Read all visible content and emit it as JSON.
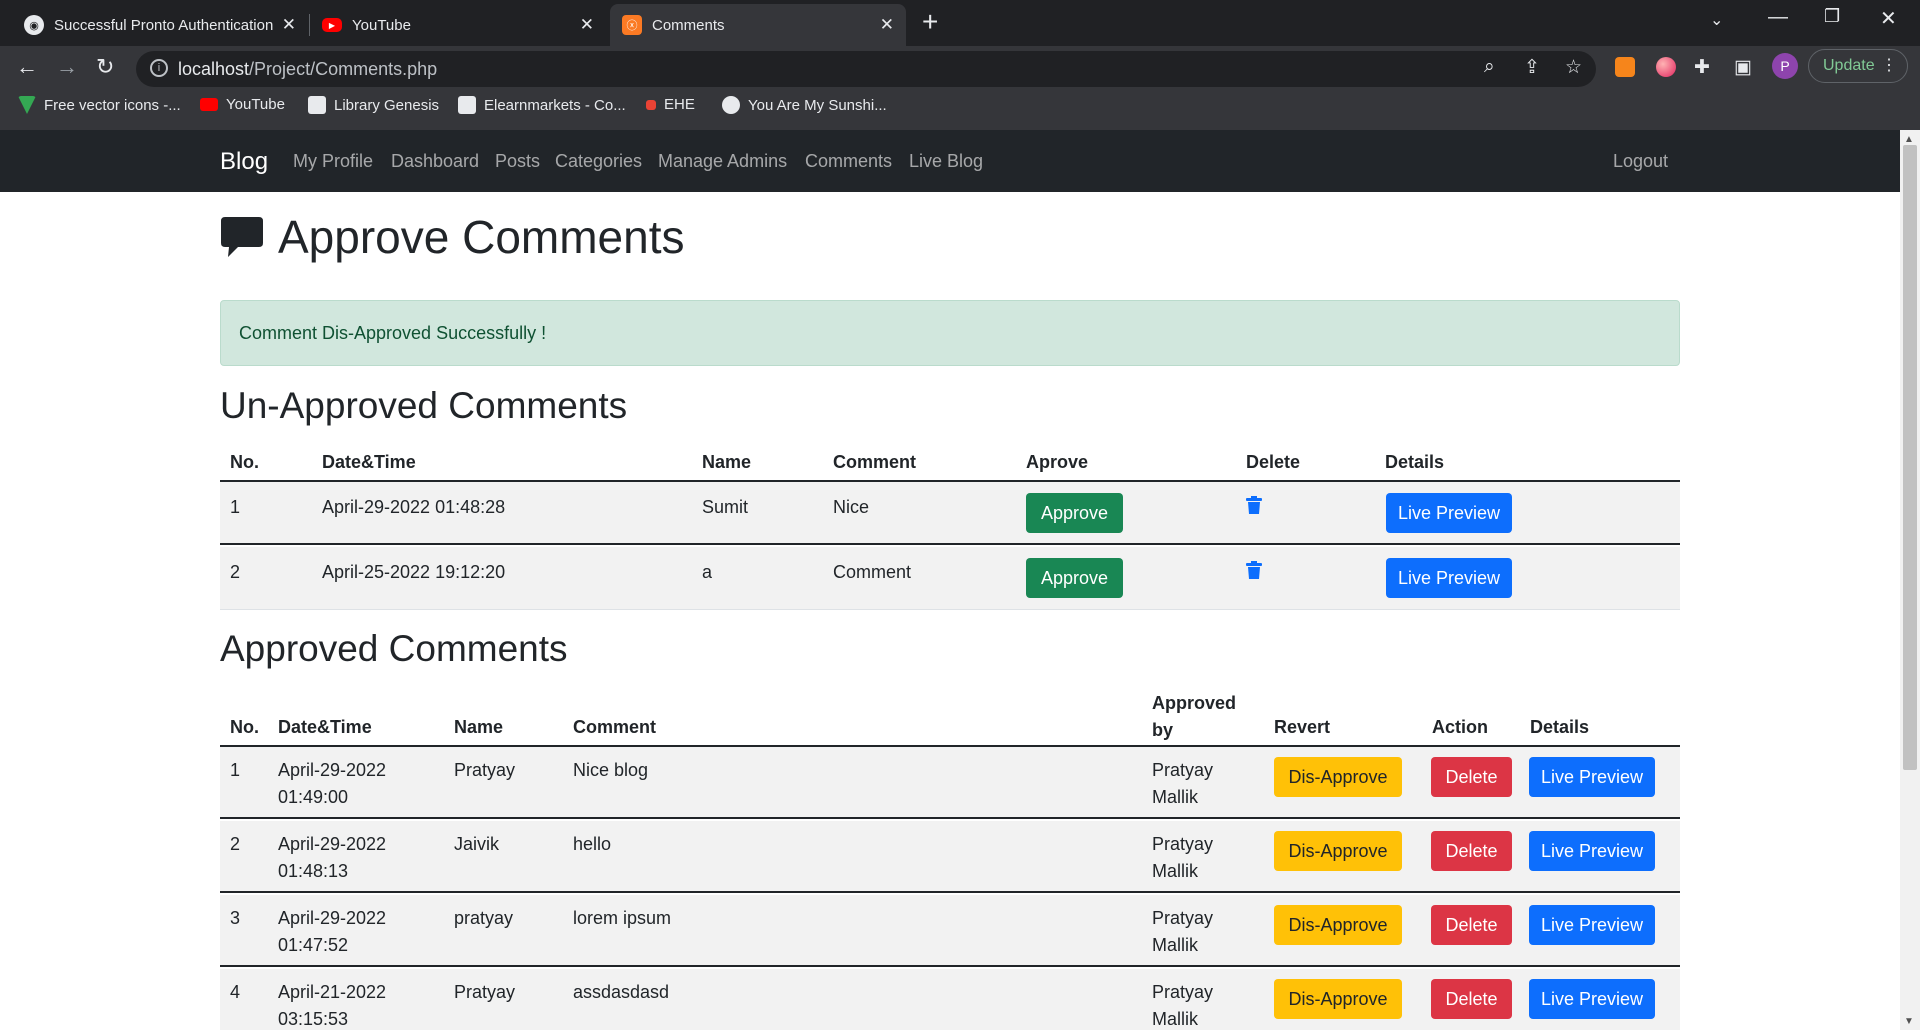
{
  "browser": {
    "tabs": [
      {
        "title": "Successful Pronto Authentication",
        "icon": "globe-icon"
      },
      {
        "title": "YouTube",
        "icon": "youtube-icon"
      },
      {
        "title": "Comments",
        "icon": "xampp-icon"
      }
    ],
    "url_host": "localhost",
    "url_path": "/Project/Comments.php",
    "update_label": "Update",
    "profile_initial": "P",
    "bookmarks": [
      {
        "label": "Free vector icons -...",
        "color": "#34a853"
      },
      {
        "label": "YouTube",
        "color": "#ff0000"
      },
      {
        "label": "Library Genesis",
        "color": "#e8eaed"
      },
      {
        "label": "Elearnmarkets - Co...",
        "color": "#e8eaed"
      },
      {
        "label": "EHE",
        "color": "#ea4335"
      },
      {
        "label": "You Are My Sunshi...",
        "color": "#e8eaed"
      }
    ]
  },
  "navbar": {
    "brand": "Blog",
    "links": [
      "My Profile",
      "Dashboard",
      "Posts",
      "Categories",
      "Manage Admins",
      "Comments",
      "Live Blog"
    ],
    "logout": "Logout"
  },
  "page": {
    "title": "Approve Comments",
    "alert": "Comment Dis-Approved Successfully !"
  },
  "unapproved": {
    "heading": "Un-Approved Comments",
    "headers": [
      "No.",
      "Date&Time",
      "Name",
      "Comment",
      "Aprove",
      "Delete",
      "Details"
    ],
    "rows": [
      {
        "no": "1",
        "datetime": "April-29-2022 01:48:28",
        "name": "Sumit",
        "comment": "Nice",
        "approve": "Approve",
        "details": "Live Preview"
      },
      {
        "no": "2",
        "datetime": "April-25-2022 19:12:20",
        "name": "a",
        "comment": "Comment",
        "approve": "Approve",
        "details": "Live Preview"
      }
    ]
  },
  "approved": {
    "heading": "Approved Comments",
    "headers": [
      "No.",
      "Date&Time",
      "Name",
      "Comment",
      "Approved by",
      "Revert",
      "Action",
      "Details"
    ],
    "rows": [
      {
        "no": "1",
        "date": "April-29-2022",
        "time": "01:49:00",
        "name": "Pratyay",
        "comment": "Nice blog",
        "by1": "Pratyay",
        "by2": "Mallik",
        "revert": "Dis-Approve",
        "action": "Delete",
        "details": "Live Preview"
      },
      {
        "no": "2",
        "date": "April-29-2022",
        "time": "01:48:13",
        "name": "Jaivik",
        "comment": "hello",
        "by1": "Pratyay",
        "by2": "Mallik",
        "revert": "Dis-Approve",
        "action": "Delete",
        "details": "Live Preview"
      },
      {
        "no": "3",
        "date": "April-29-2022",
        "time": "01:47:52",
        "name": "pratyay",
        "comment": "lorem ipsum",
        "by1": "Pratyay",
        "by2": "Mallik",
        "revert": "Dis-Approve",
        "action": "Delete",
        "details": "Live Preview"
      },
      {
        "no": "4",
        "date": "April-21-2022",
        "time": "03:15:53",
        "name": "Pratyay",
        "comment": "assdasdasd",
        "by1": "Pratyay",
        "by2": "Mallik",
        "revert": "Dis-Approve",
        "action": "Delete",
        "details": "Live Preview"
      }
    ]
  },
  "colors": {
    "success": "#198754",
    "primary": "#0d6efd",
    "warning": "#ffc107",
    "danger": "#dc3545",
    "navbar": "#212529",
    "alert_bg": "#d1e7dd"
  }
}
